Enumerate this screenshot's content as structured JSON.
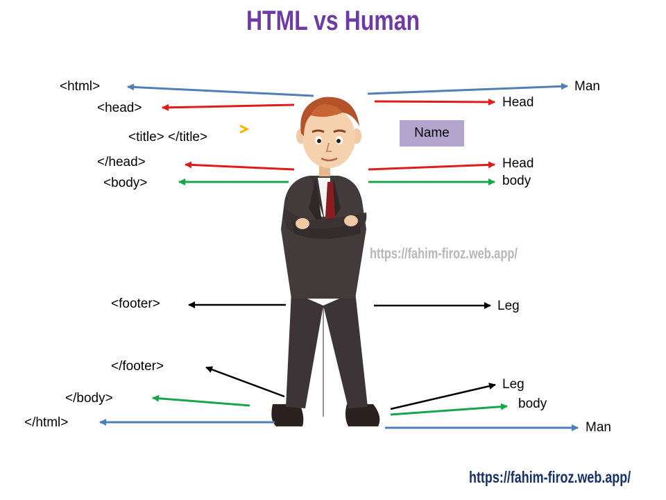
{
  "title": "HTML vs Human",
  "left_labels": {
    "html_open": "<html>",
    "head_open": "<head>",
    "title_tags": "<title> </title>",
    "head_close": "</head>",
    "body_open": "<body>",
    "footer_open": "<footer>",
    "footer_close": "</footer>",
    "body_close": "</body>",
    "html_close": "</html>"
  },
  "right_labels": {
    "man_top": "Man",
    "head_top": "Head",
    "name": "Name",
    "head_bottom": "Head",
    "body_top": "body",
    "leg_top": "Leg",
    "leg_bottom": "Leg",
    "body_bottom": "body",
    "man_bottom": "Man"
  },
  "watermarks": {
    "center": "https://fahim-firoz.web.app/",
    "footer": "https://fahim-firoz.web.app/"
  },
  "colors": {
    "title": "#6e3aa6",
    "html_arrows": "#4f7fb5",
    "head_arrows": "#e01b1b",
    "body_arrows": "#18a64a",
    "footer_arrows": "#000000",
    "name_box": "#b4a5cf",
    "pointer": "#f2b800"
  }
}
